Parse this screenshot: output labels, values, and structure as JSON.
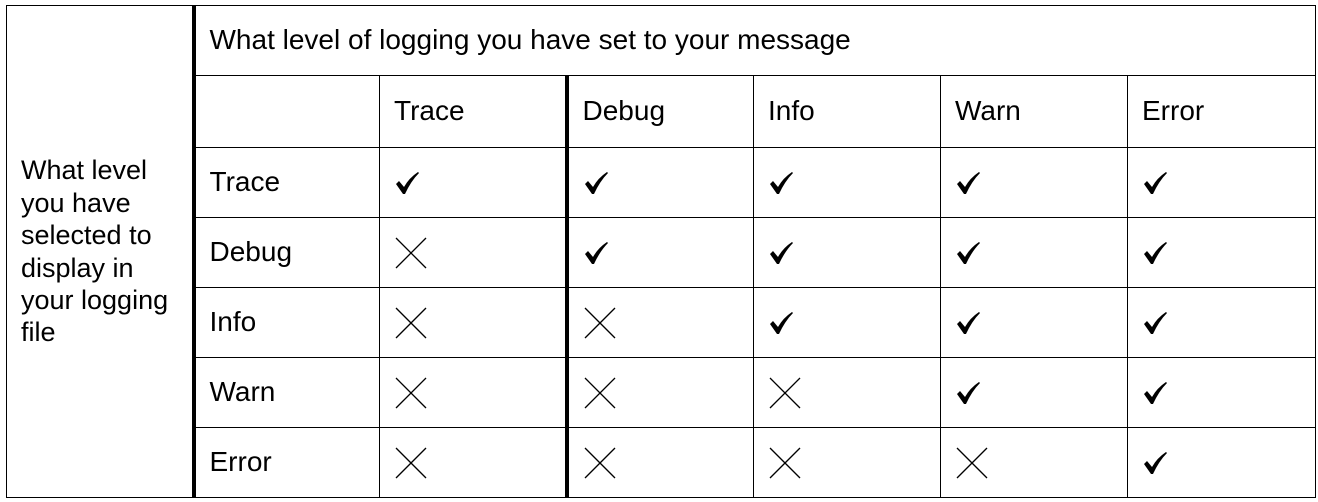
{
  "corner_label": "What level you have selected to display in your logging file",
  "group_header": "What level of logging you have set to your message",
  "columns": [
    "Trace",
    "Debug",
    "Info",
    "Warn",
    "Error"
  ],
  "rows": [
    {
      "label": "Trace",
      "cells": [
        "check",
        "check",
        "check",
        "check",
        "check"
      ]
    },
    {
      "label": "Debug",
      "cells": [
        "cross",
        "check",
        "check",
        "check",
        "check"
      ]
    },
    {
      "label": "Info",
      "cells": [
        "cross",
        "cross",
        "check",
        "check",
        "check"
      ]
    },
    {
      "label": "Warn",
      "cells": [
        "cross",
        "cross",
        "cross",
        "check",
        "check"
      ]
    },
    {
      "label": "Error",
      "cells": [
        "cross",
        "cross",
        "cross",
        "cross",
        "check"
      ]
    }
  ],
  "icons": {
    "check": "check-icon",
    "cross": "cross-icon"
  }
}
